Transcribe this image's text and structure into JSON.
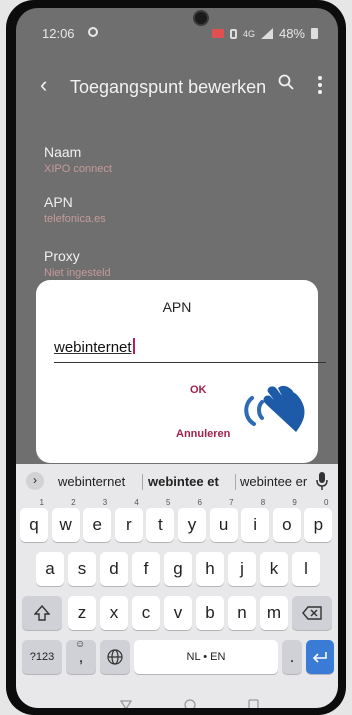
{
  "status": {
    "time": "12:06",
    "battery": "48%",
    "network": "4G"
  },
  "appbar": {
    "title": "Toegangspunt bewerken",
    "back_icon": "arrow-left-icon",
    "search_icon": "search-icon",
    "more_icon": "more-vert-icon"
  },
  "settings": [
    {
      "label": "Naam",
      "value": "XIPO connect"
    },
    {
      "label": "APN",
      "value": "telefonica.es"
    },
    {
      "label": "Proxy",
      "value": "Niet ingesteld"
    }
  ],
  "dialog": {
    "title": "APN",
    "input_value": "webinternet",
    "ok": "OK",
    "cancel": "Annuleren",
    "accent": "#a0224b"
  },
  "keyboard": {
    "suggestions": [
      "webinternet",
      "webintee et",
      "webintee er"
    ],
    "row1": [
      {
        "k": "q",
        "n": "1"
      },
      {
        "k": "w",
        "n": "2"
      },
      {
        "k": "e",
        "n": "3"
      },
      {
        "k": "r",
        "n": "4"
      },
      {
        "k": "t",
        "n": "5"
      },
      {
        "k": "y",
        "n": "6"
      },
      {
        "k": "u",
        "n": "7"
      },
      {
        "k": "i",
        "n": "8"
      },
      {
        "k": "o",
        "n": "9"
      },
      {
        "k": "p",
        "n": "0"
      }
    ],
    "row2": [
      "a",
      "s",
      "d",
      "f",
      "g",
      "h",
      "j",
      "k",
      "l"
    ],
    "row3": [
      "z",
      "x",
      "c",
      "v",
      "b",
      "n",
      "m"
    ],
    "symbols": "?123",
    "comma": ",",
    "space": "NL • EN",
    "period": ".",
    "enter_color": "#3a7bd5"
  }
}
